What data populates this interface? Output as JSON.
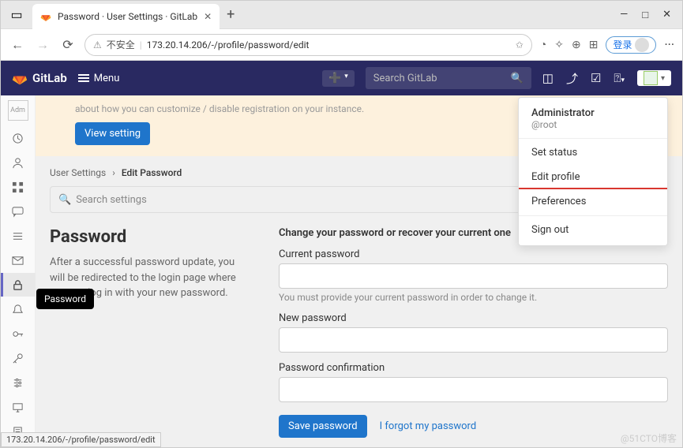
{
  "browser": {
    "tab_title": "Password · User Settings · GitLab",
    "new_tab": "+",
    "win_min": "—",
    "win_max": "□",
    "win_close": "✕",
    "unsafe_label": "不安全",
    "url": "173.20.14.206/-/profile/password/edit",
    "login_label": "登录",
    "more": "···"
  },
  "topbar": {
    "brand": "GitLab",
    "menu": "Menu",
    "search_placeholder": "Search GitLab"
  },
  "banner": {
    "truncated_text": "about how you can customize / disable registration on your instance.",
    "button": "View setting"
  },
  "breadcrumbs": {
    "root": "User Settings",
    "sep": "›",
    "current": "Edit Password"
  },
  "search_settings_placeholder": "Search settings",
  "left": {
    "title": "Password",
    "desc": "After a successful password update, you will be redirected to the login page where you can log in with your new password."
  },
  "right": {
    "heading": "Change your password or recover your current one",
    "current_label": "Current password",
    "current_hint": "You must provide your current password in order to change it.",
    "new_label": "New password",
    "confirm_label": "Password confirmation",
    "save": "Save password",
    "forgot": "I forgot my password"
  },
  "tooltip": "Password",
  "dropdown": {
    "name": "Administrator",
    "handle": "@root",
    "status": "Set status",
    "edit": "Edit profile",
    "prefs": "Preferences",
    "signout": "Sign out"
  },
  "rail_avatar": "Adm",
  "status_url": "173.20.14.206/-/profile/password/edit",
  "watermark": "@51CTO博客"
}
